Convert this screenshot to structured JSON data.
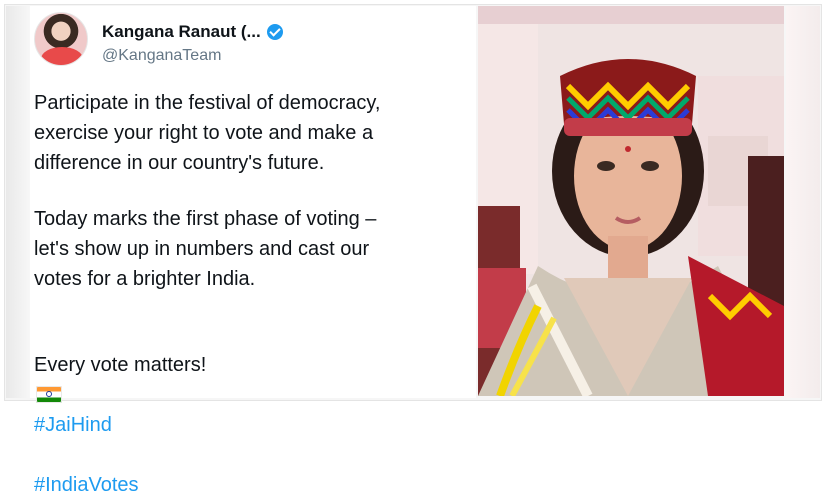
{
  "tweet": {
    "author": {
      "name": "Kangana Ranaut (...",
      "handle": "@KanganaTeam",
      "verified": true
    },
    "paragraphs": [
      {
        "text": "Participate in the festival of democracy,\nexercise your right to vote and make a\ndifference in our country's future."
      },
      {
        "text": "Today marks the first phase of voting –\nlet's show up in numbers and cast our\nvotes for a brighter India."
      }
    ],
    "closing": {
      "text": "Every vote matters!",
      "emoji": "india-flag-icon",
      "hashtags": [
        "#JaiHind",
        "#IndiaVotes"
      ]
    }
  },
  "colors": {
    "hashtag": "#1d9bf0",
    "verified": "#1d9bf0",
    "text": "#0f1419",
    "handle": "#657786"
  },
  "photo": {
    "description_icon": "woman-with-himachali-cap"
  }
}
